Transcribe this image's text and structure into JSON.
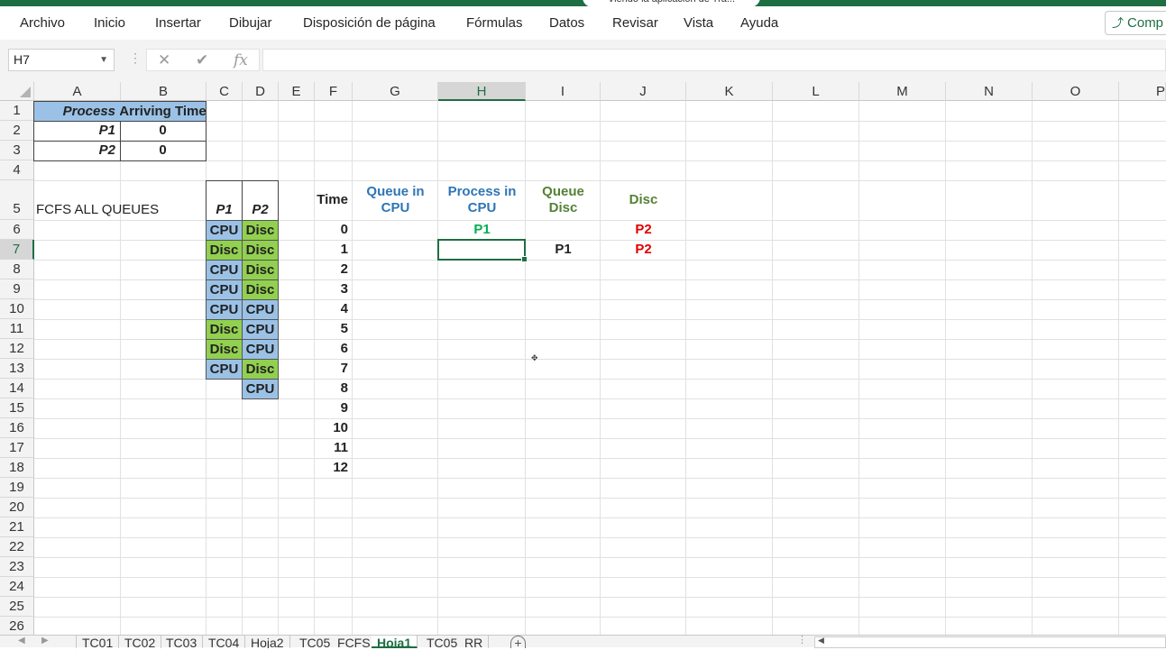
{
  "window": {
    "title_fragment": "Viendo la aplicación de Tra..."
  },
  "ribbon": {
    "tabs": [
      "Archivo",
      "Inicio",
      "Insertar",
      "Dibujar",
      "Disposición de página",
      "Fórmulas",
      "Datos",
      "Revisar",
      "Vista",
      "Ayuda"
    ],
    "share_label": "Comp"
  },
  "formula_bar": {
    "name_box": "H7",
    "formula": ""
  },
  "columns": [
    "A",
    "B",
    "C",
    "D",
    "E",
    "F",
    "G",
    "H",
    "I",
    "J",
    "K",
    "L",
    "M",
    "N",
    "O",
    "P"
  ],
  "selected_column": "H",
  "rows": [
    "1",
    "2",
    "3",
    "4",
    "5",
    "6",
    "7",
    "8",
    "9",
    "10",
    "11",
    "12",
    "13",
    "14",
    "15",
    "16",
    "17",
    "18",
    "19",
    "20",
    "21",
    "22",
    "23",
    "24",
    "25",
    "26"
  ],
  "selected_row": "7",
  "process_table": {
    "header_process": "Process",
    "header_arriving": "Arriving Time",
    "rows": [
      {
        "process": "P1",
        "arriving": "0"
      },
      {
        "process": "P2",
        "arriving": "0"
      }
    ]
  },
  "label_fcfs": "FCFS ALL QUEUES",
  "bursts": {
    "p1_header": "P1",
    "p2_header": "P2",
    "p1": [
      "CPU",
      "Disc",
      "CPU",
      "CPU",
      "CPU",
      "Disc",
      "Disc",
      "CPU"
    ],
    "p2": [
      "Disc",
      "Disc",
      "Disc",
      "Disc",
      "CPU",
      "CPU",
      "CPU",
      "Disc",
      "CPU"
    ]
  },
  "timeline": {
    "time_header": "Time",
    "times": [
      "0",
      "1",
      "2",
      "3",
      "4",
      "5",
      "6",
      "7",
      "8",
      "9",
      "10",
      "11",
      "12"
    ],
    "queue_cpu_header": "Queue in CPU",
    "process_cpu_header": "Process in CPU",
    "queue_disc_header": "Queue Disc",
    "disc_header": "Disc",
    "process_cpu_values": [
      "P1",
      ""
    ],
    "queue_disc_values": [
      "",
      "P1"
    ],
    "disc_values": [
      "P2",
      "P2"
    ]
  },
  "colors": {
    "excel_green": "#1e6e43",
    "header_blue": "#9bc2e6",
    "cpu_blue": "#9bc2e6",
    "disc_green": "#92d050",
    "queue_cpu_text": "#2e75b6",
    "queue_disc_text": "#548235",
    "p1_green": "#00b050",
    "p2_red": "#e00000"
  },
  "sheets": {
    "tabs": [
      "TC01",
      "TC02",
      "TC03",
      "TC04",
      "Hoja2",
      "TC05_FCFS",
      "Hoja1",
      "TC05_RR"
    ],
    "active": "Hoja1"
  }
}
